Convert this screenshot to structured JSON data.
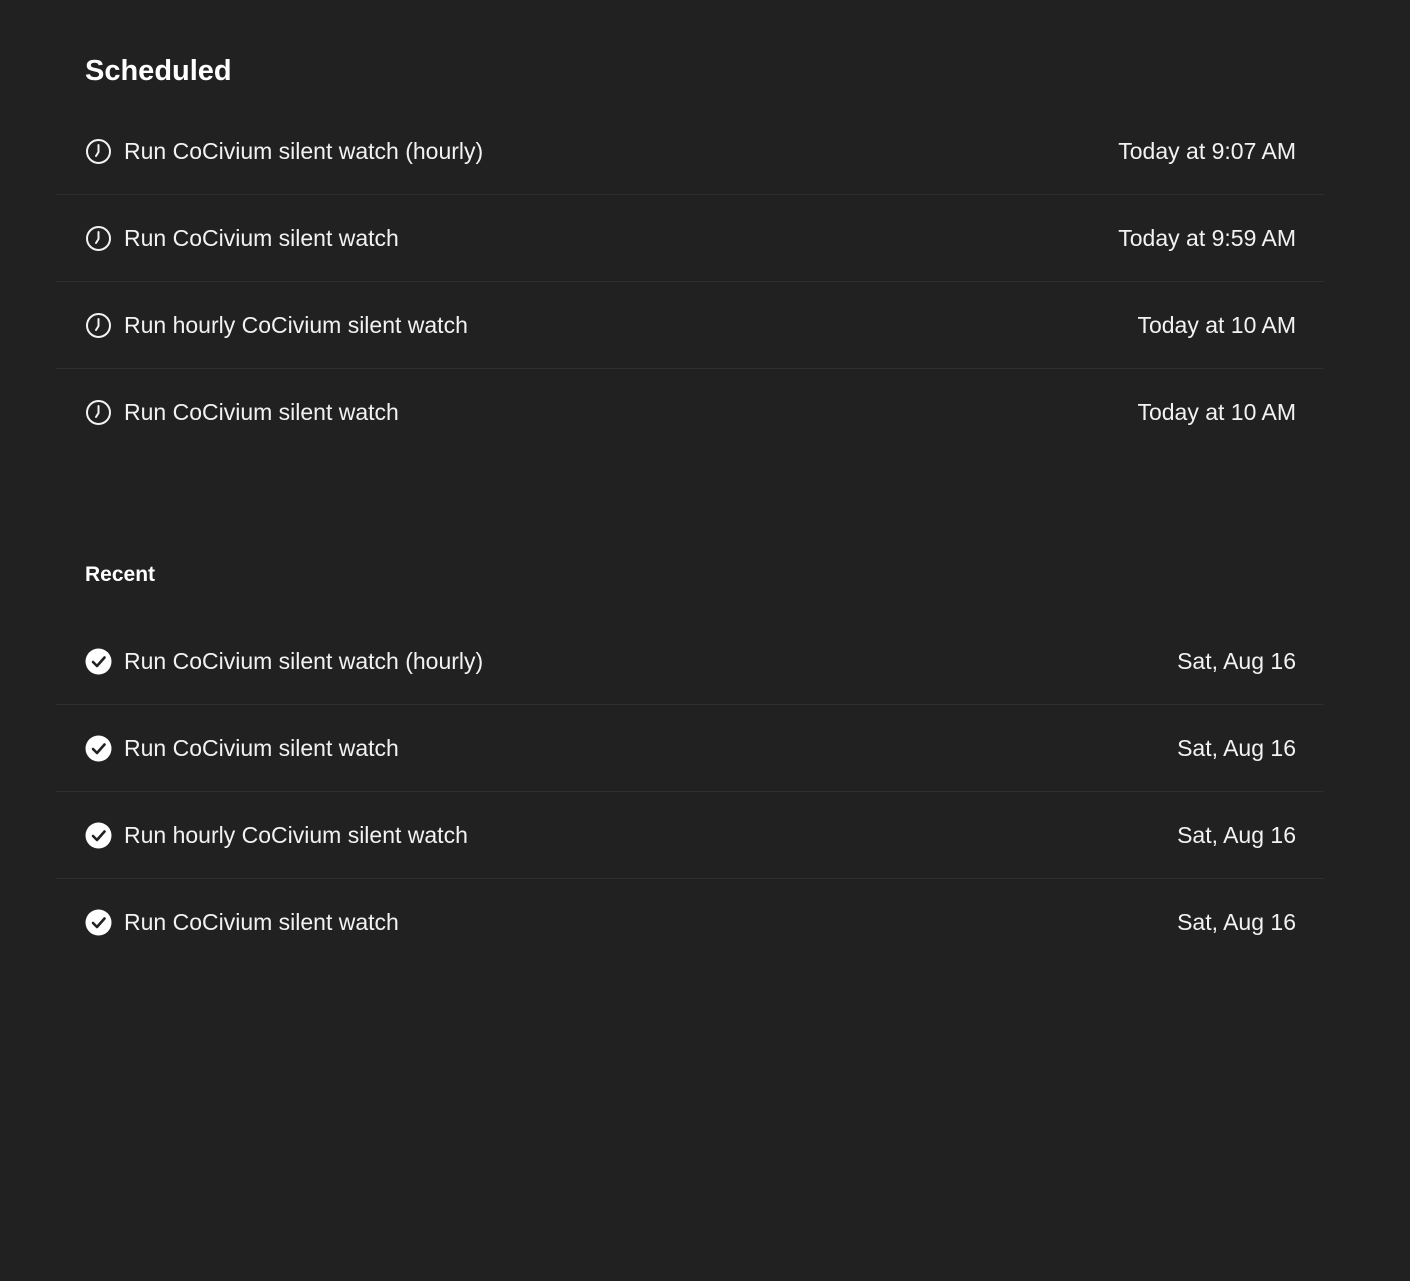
{
  "scheduled": {
    "title": "Scheduled",
    "items": [
      {
        "label": "Run CoCivium silent watch (hourly)",
        "time": "Today at 9:07 AM",
        "icon": "clock-icon"
      },
      {
        "label": "Run CoCivium silent watch",
        "time": "Today at 9:59 AM",
        "icon": "clock-icon"
      },
      {
        "label": "Run hourly CoCivium silent watch",
        "time": "Today at 10 AM",
        "icon": "clock-icon"
      },
      {
        "label": "Run CoCivium silent watch",
        "time": "Today at 10 AM",
        "icon": "clock-icon"
      }
    ]
  },
  "recent": {
    "title": "Recent",
    "items": [
      {
        "label": "Run CoCivium silent watch (hourly)",
        "time": "Sat, Aug 16",
        "icon": "check-circle-icon"
      },
      {
        "label": "Run CoCivium silent watch",
        "time": "Sat, Aug 16",
        "icon": "check-circle-icon"
      },
      {
        "label": "Run hourly CoCivium silent watch",
        "time": "Sat, Aug 16",
        "icon": "check-circle-icon"
      },
      {
        "label": "Run CoCivium silent watch",
        "time": "Sat, Aug 16",
        "icon": "check-circle-icon"
      }
    ]
  },
  "colors": {
    "background": "#212121",
    "text": "#f2f2f2",
    "divider": "#2e2e2e"
  }
}
